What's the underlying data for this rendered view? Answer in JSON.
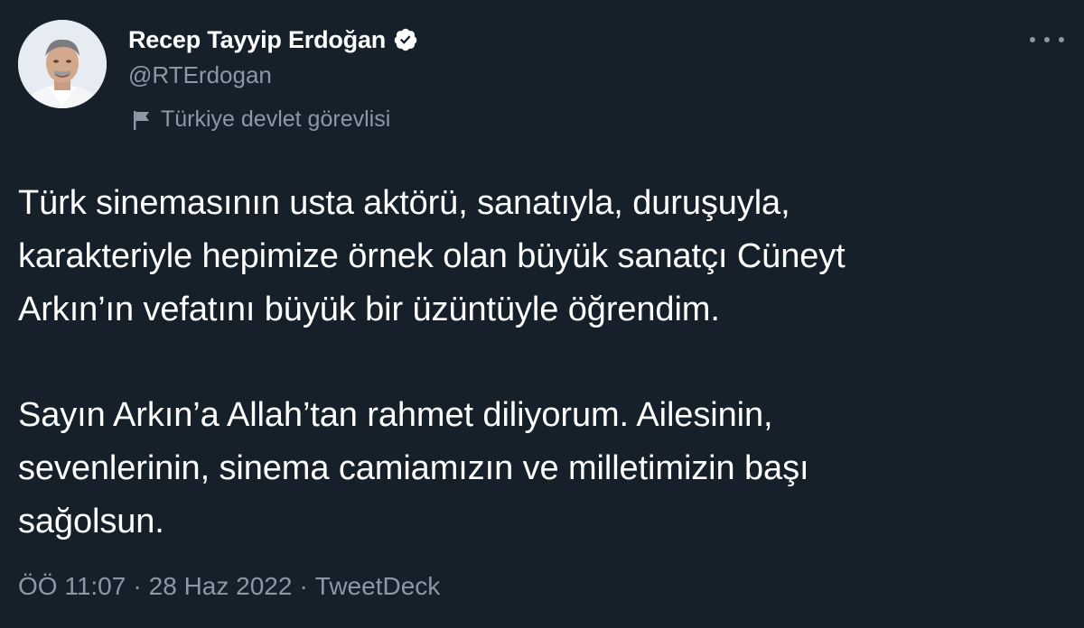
{
  "author": {
    "display_name": "Recep Tayyip Erdoğan",
    "handle": "@RTErdogan",
    "verified": true,
    "label": "Türkiye devlet görevlisi"
  },
  "tweet": {
    "paragraph_1": "Türk sinemasının usta aktörü, sanatıyla, duruşuyla,\nkarakteriyle hepimize örnek olan büyük sanatçı Cüneyt\nArkın’ın vefatını büyük bir üzüntüyle öğrendim.",
    "paragraph_2": "Sayın Arkın’a Allah’tan rahmet diliyorum. Ailesinin,\nsevenlerinin, sinema camiamızın ve milletimizin başı\nsağolsun."
  },
  "meta": {
    "time": "ÖÖ 11:07",
    "separator": "·",
    "date": "28 Haz 2022",
    "source": "TweetDeck"
  },
  "icons": {
    "verified": "verified-badge-icon",
    "label": "flag-icon",
    "more": "more-horizontal-icon"
  },
  "colors": {
    "background": "#15202b",
    "primary_text": "#ffffff",
    "secondary_text": "#8b98a5"
  }
}
